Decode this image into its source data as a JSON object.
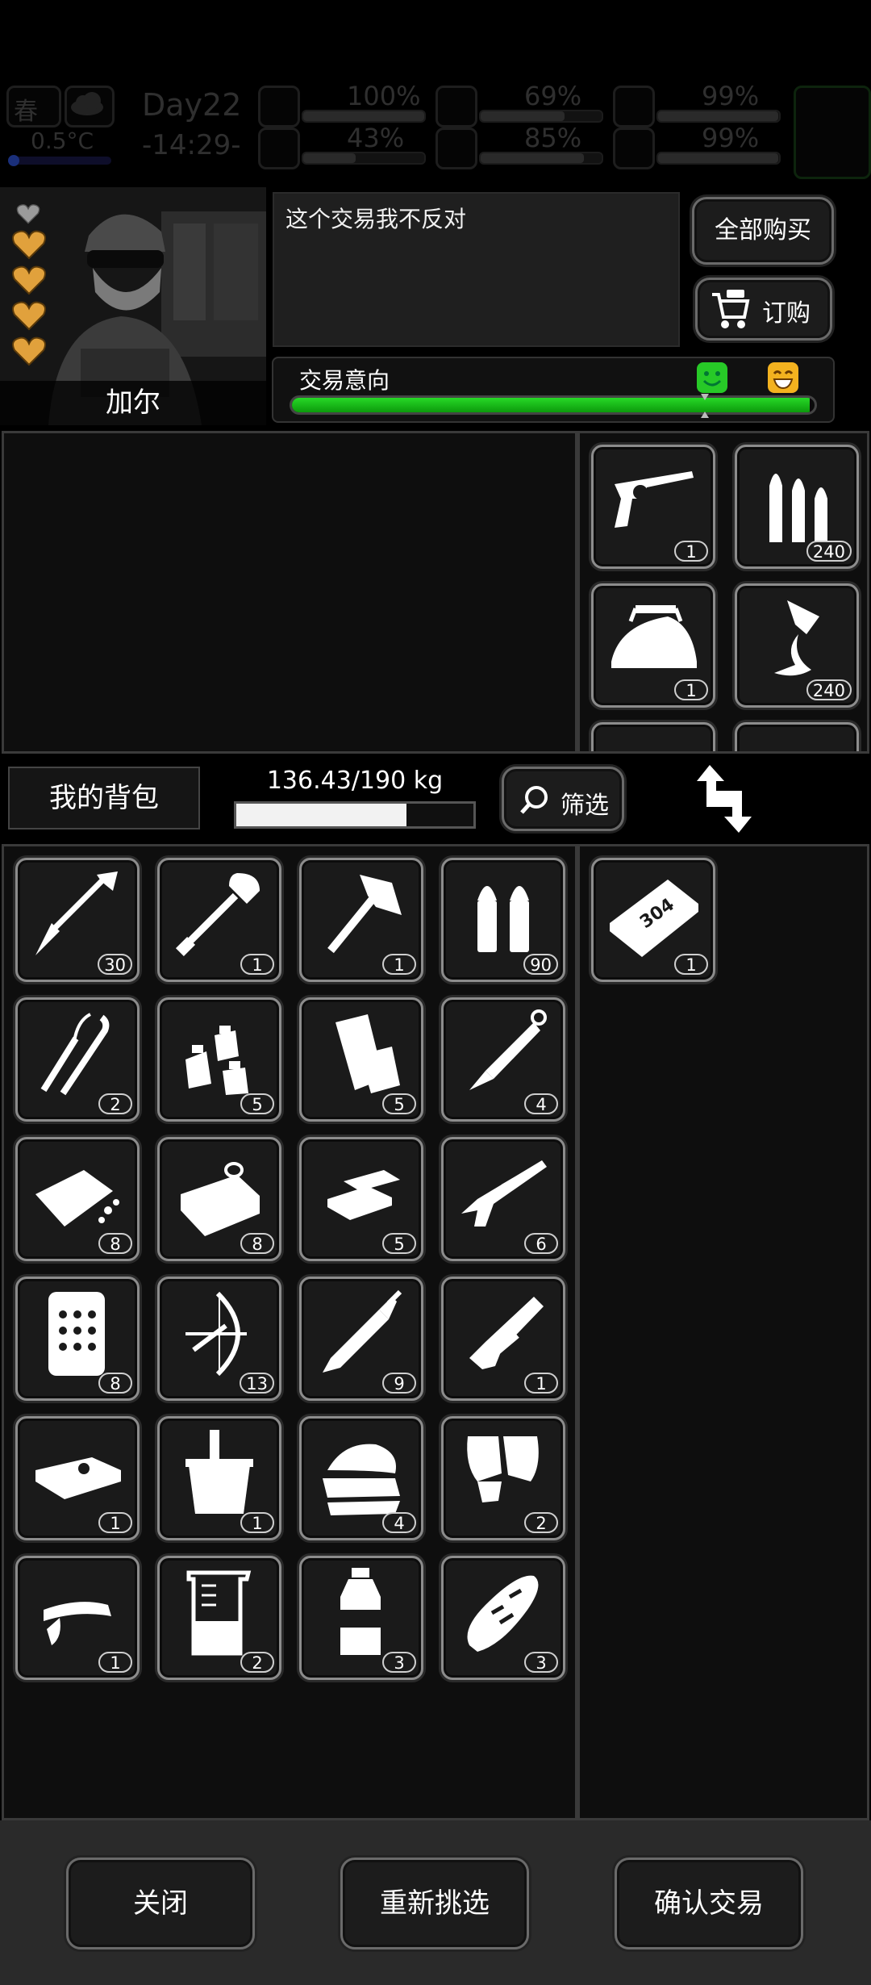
{
  "status_bar": {
    "season": "春",
    "temperature": "0.5°C",
    "day": "Day22",
    "time": "-14:29-",
    "stats": [
      {
        "icon": "medkit-icon",
        "value": "100%",
        "level": 1.0
      },
      {
        "icon": "stomach-icon",
        "value": "69%",
        "level": 0.69
      },
      {
        "icon": "bladder-icon",
        "value": "99%",
        "level": 0.99
      },
      {
        "icon": "boot-icon",
        "value": "43%",
        "level": 0.43
      },
      {
        "icon": "water-drop-icon",
        "value": "85%",
        "level": 0.85
      },
      {
        "icon": "heart-icon",
        "value": "99%",
        "level": 0.99
      }
    ]
  },
  "trader": {
    "name": "加尔",
    "dialog": "这个交易我不反对",
    "hearts": {
      "filled": 4,
      "empty": 1
    },
    "buy_all_label": "全部购买",
    "order_label": "订购",
    "intent_label": "交易意向",
    "intent_level": 0.99
  },
  "trader_items": [
    {
      "icon": "revolver-icon",
      "count": "1"
    },
    {
      "icon": "rifle-bullets-icon",
      "count": "240"
    },
    {
      "icon": "iron-icon",
      "count": "1"
    },
    {
      "icon": "glue-icon",
      "count": "240"
    }
  ],
  "bag": {
    "title": "我的背包",
    "weight": "136.43/190 kg",
    "weight_level": 0.718,
    "filter_label": "筛选",
    "items": [
      {
        "icon": "arrow-icon",
        "count": "30"
      },
      {
        "icon": "shovel-icon",
        "count": "1"
      },
      {
        "icon": "axe-icon",
        "count": "1"
      },
      {
        "icon": "pistol-ammo-icon",
        "count": "90"
      },
      {
        "icon": "lockpick-icon",
        "count": "2"
      },
      {
        "icon": "gunpowder-icon",
        "count": "5"
      },
      {
        "icon": "cloth-roll-icon",
        "count": "5"
      },
      {
        "icon": "knife-icon",
        "count": "4"
      },
      {
        "icon": "bread-crumb-icon",
        "count": "8"
      },
      {
        "icon": "tin-can-icon",
        "count": "8"
      },
      {
        "icon": "gold-bars-icon",
        "count": "5"
      },
      {
        "icon": "shotgun-icon",
        "count": "6"
      },
      {
        "icon": "body-armor-plate-icon",
        "count": "8"
      },
      {
        "icon": "compound-bow-icon",
        "count": "13"
      },
      {
        "icon": "sword-icon",
        "count": "9"
      },
      {
        "icon": "minigun-icon",
        "count": "1"
      },
      {
        "icon": "cash-bundle-icon",
        "count": "1"
      },
      {
        "icon": "bucket-icon",
        "count": "1"
      },
      {
        "icon": "towels-icon",
        "count": "4"
      },
      {
        "icon": "gloves-icon",
        "count": "2"
      },
      {
        "icon": "visor-cap-icon",
        "count": "1"
      },
      {
        "icon": "beaker-icon",
        "count": "2"
      },
      {
        "icon": "water-bottle-icon",
        "count": "3"
      },
      {
        "icon": "baguette-icon",
        "count": "3"
      }
    ]
  },
  "offer_items": [
    {
      "icon": "steel-plate-304-icon",
      "label": "304",
      "count": "1"
    }
  ],
  "actions": {
    "close_label": "关闭",
    "reselect_label": "重新挑选",
    "confirm_label": "确认交易"
  },
  "colors": {
    "intent_green": "#1fcf1f",
    "heart_gold": "#e1a13c",
    "slot_border": "#8c8c8c"
  }
}
